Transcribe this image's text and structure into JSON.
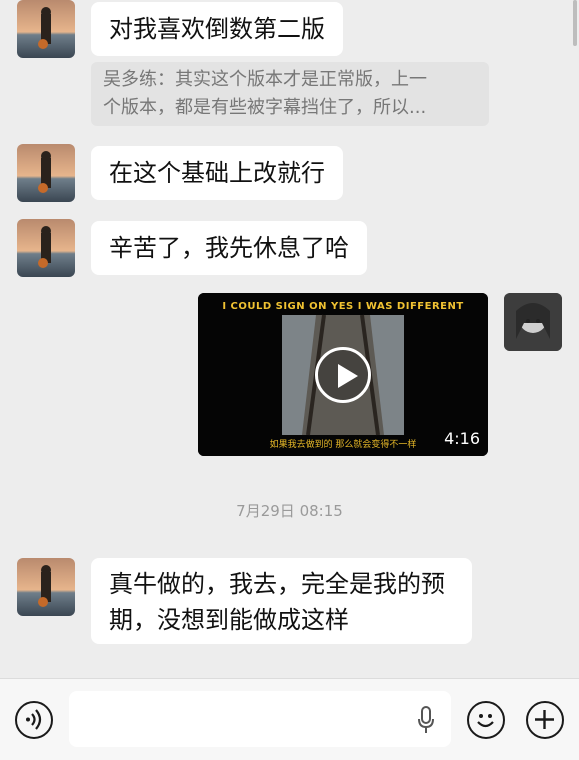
{
  "messages": [
    {
      "text": "对我喜欢倒数第二版"
    },
    {
      "quote_line1": "吴多练：其实这个版本才是正常版，上一",
      "quote_line2": "个版本，都是有些被字幕挡住了，所以..."
    },
    {
      "text": "在这个基础上改就行"
    },
    {
      "text": "辛苦了，我先休息了哈"
    },
    {
      "video_caption": "I COULD SIGN ON YES I WAS DIFFERENT",
      "video_subtitle": "如果我去做到的  那么就会变得不一样",
      "video_duration": "4:16"
    },
    {
      "timestamp": "7月29日 08:15"
    },
    {
      "text_line1": "真牛做的，我去，完全是我的预",
      "text_line2": "期，没想到能做成这样"
    }
  ],
  "input": {
    "placeholder": "",
    "value": ""
  },
  "icons": {
    "voice": "voice-mode-icon",
    "mic": "microphone-icon",
    "emoji": "emoji-icon",
    "plus": "plus-icon"
  },
  "colors": {
    "background": "#ededed",
    "bubble": "#ffffff",
    "quote_bg": "#e3e3e3"
  }
}
